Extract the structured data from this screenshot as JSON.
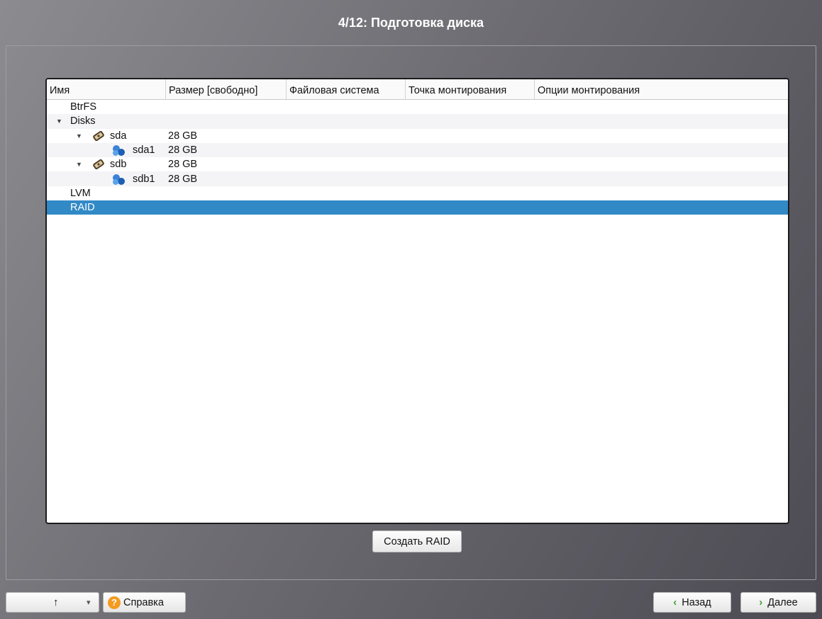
{
  "window": {
    "title": "4/12: Подготовка диска"
  },
  "table": {
    "columns": [
      "Имя",
      "Размер [свободно]",
      "Файловая система",
      "Точка монтирования",
      "Опции монтирования"
    ],
    "rows": [
      {
        "name": "BtrFS",
        "size": ""
      },
      {
        "name": "Disks",
        "size": "",
        "expander": "▼"
      },
      {
        "name": "sda",
        "size": "28 GB",
        "expander": "▼",
        "icon": "hard-disk-icon"
      },
      {
        "name": "sda1",
        "size": "28 GB",
        "icon": "partition-icon"
      },
      {
        "name": "sdb",
        "size": "28 GB",
        "expander": "▼",
        "icon": "hard-disk-icon"
      },
      {
        "name": "sdb1",
        "size": "28 GB",
        "icon": "partition-icon"
      },
      {
        "name": "LVM",
        "size": ""
      },
      {
        "name": "RAID",
        "size": "",
        "selected": true
      }
    ]
  },
  "actions": {
    "create_raid": "Создать RAID"
  },
  "footer": {
    "up_arrow": "↑",
    "dropdown_arrow": "▾",
    "help_icon_glyph": "?",
    "help": "Справка",
    "back_glyph": "‹",
    "back": "Назад",
    "next_glyph": "›",
    "next": "Далее"
  },
  "colors": {
    "selection": "#3189c6",
    "help_icon": "#f59a1e",
    "nav_arrow": "#3aa12e"
  }
}
